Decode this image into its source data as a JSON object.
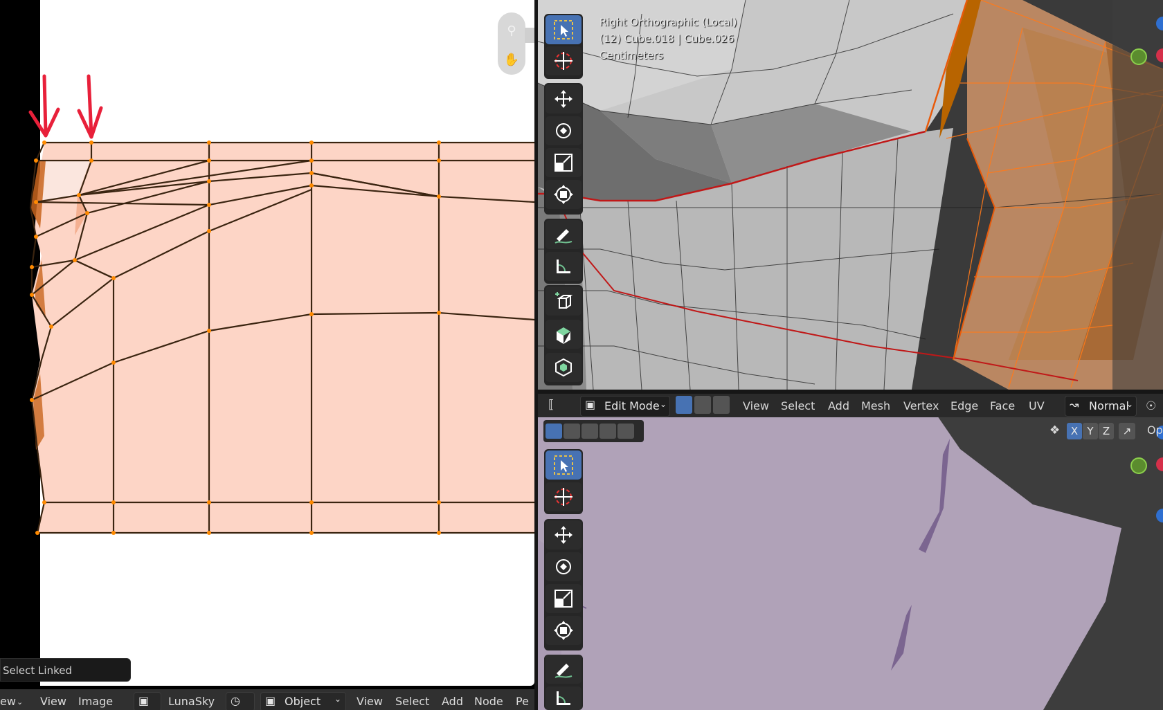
{
  "uv_editor": {
    "operator_panel": "Select Linked",
    "header": {
      "view_menu_partial": "ew",
      "menus": [
        "View",
        "Image"
      ],
      "image_name": "LunaSky",
      "mode": "Object",
      "node_menus": [
        "View",
        "Select",
        "Add",
        "Node",
        "Pe"
      ]
    }
  },
  "viewport_top": {
    "info_lines": [
      "Right Orthographic (Local)",
      "(12) Cube.018 | Cube.026",
      "Centimeters"
    ]
  },
  "viewport_bottom": {
    "mode": "Edit Mode",
    "menus": [
      "View",
      "Select",
      "Add",
      "Mesh",
      "Vertex",
      "Edge",
      "Face",
      "UV"
    ],
    "orientation": "Normal",
    "mirror_axes": [
      "X",
      "Y",
      "Z"
    ],
    "options_partial": "Op"
  },
  "tools": [
    "select-box",
    "cursor",
    "move",
    "rotate",
    "scale",
    "transform",
    "annotate",
    "measure",
    "add-cube",
    "extrude",
    "inset"
  ],
  "colors": {
    "uv_fill": "#fdd5c6",
    "uv_edge": "#3a2410",
    "uv_vertex": "#ff8a00",
    "arrow": "#e8203a",
    "active_blue": "#4772b3",
    "mesh_purple": "#b0a2b8"
  }
}
